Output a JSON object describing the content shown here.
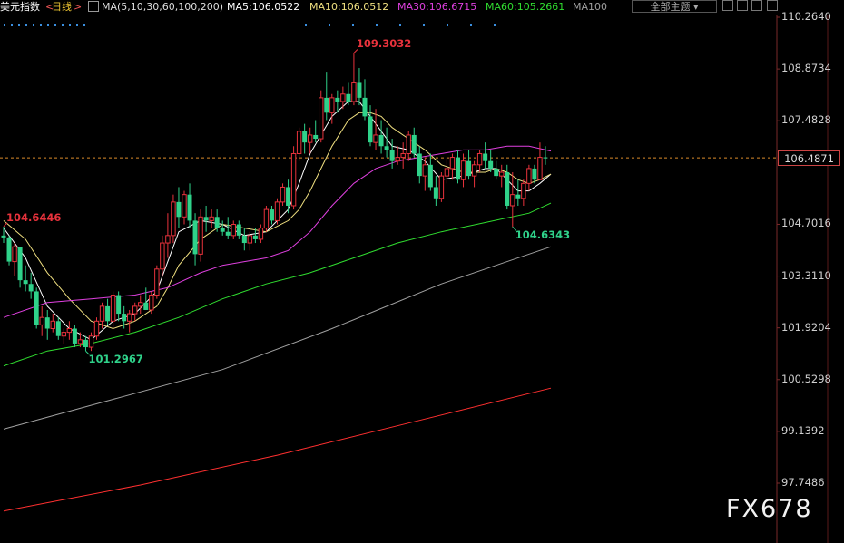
{
  "header": {
    "instrument": "美元指数",
    "period": "日线",
    "indicator": "MA(5,10,30,60,100,200)",
    "ma5": "MA5:106.0522",
    "ma10": "MA10:106.0512",
    "ma30": "MA30:106.6715",
    "ma60": "MA60:105.2661",
    "ma100": "MA100",
    "theme_button": "全部主题"
  },
  "watermark": "FX678",
  "colors": {
    "up": "#e8323c",
    "down": "#2fd28a",
    "ma5": "#ffffff",
    "ma10": "#f0e080",
    "ma30": "#e040e0",
    "ma60": "#30dd30",
    "ma100": "#a0a0a0",
    "ma200": "#ff3030",
    "grid": "#7a2a2a"
  },
  "chart_data": {
    "type": "candlestick",
    "ylim": [
      96.9,
      110.7
    ],
    "y_ticks": [
      "110.2640",
      "108.8734",
      "107.4828",
      "104.7016",
      "103.3110",
      "101.9204",
      "100.5298",
      "99.1392",
      "97.7486"
    ],
    "current_price": "106.4871",
    "annotations": [
      {
        "text": "109.3032",
        "value": 109.3032,
        "index": 64,
        "color": "up"
      },
      {
        "text": "104.6446",
        "value": 104.6446,
        "index": 0,
        "color": "up"
      },
      {
        "text": "101.2967",
        "value": 101.2967,
        "index": 15,
        "color": "down"
      },
      {
        "text": "104.6343",
        "value": 104.6343,
        "index": 93,
        "color": "down"
      }
    ],
    "candles": [
      [
        104.4,
        104.64,
        104.2,
        104.35
      ],
      [
        104.35,
        104.4,
        103.6,
        103.7
      ],
      [
        103.7,
        104.2,
        103.3,
        104.1
      ],
      [
        104.1,
        104.1,
        103.0,
        103.2
      ],
      [
        103.2,
        103.6,
        102.9,
        103.1
      ],
      [
        103.1,
        103.4,
        102.7,
        102.9
      ],
      [
        102.9,
        103.0,
        101.9,
        102.0
      ],
      [
        102.0,
        102.5,
        101.7,
        102.2
      ],
      [
        102.2,
        102.4,
        101.6,
        101.9
      ],
      [
        101.9,
        102.3,
        101.8,
        102.1
      ],
      [
        102.1,
        102.2,
        101.6,
        101.7
      ],
      [
        101.7,
        101.9,
        101.5,
        101.8
      ],
      [
        101.8,
        102.1,
        101.6,
        101.9
      ],
      [
        101.9,
        102.0,
        101.4,
        101.5
      ],
      [
        101.5,
        101.8,
        101.4,
        101.6
      ],
      [
        101.6,
        101.7,
        101.3,
        101.4
      ],
      [
        101.4,
        101.8,
        101.3,
        101.7
      ],
      [
        101.7,
        102.2,
        101.6,
        102.1
      ],
      [
        102.1,
        102.6,
        101.9,
        102.5
      ],
      [
        102.5,
        102.7,
        102.0,
        102.1
      ],
      [
        102.1,
        102.9,
        101.9,
        102.8
      ],
      [
        102.8,
        102.9,
        102.1,
        102.3
      ],
      [
        102.3,
        102.5,
        101.9,
        102.1
      ],
      [
        102.1,
        102.4,
        101.8,
        102.3
      ],
      [
        102.3,
        102.6,
        102.1,
        102.5
      ],
      [
        102.5,
        102.8,
        102.3,
        102.6
      ],
      [
        102.6,
        103.0,
        102.4,
        102.4
      ],
      [
        102.4,
        102.9,
        102.3,
        102.8
      ],
      [
        102.8,
        103.6,
        102.7,
        103.5
      ],
      [
        103.5,
        104.4,
        103.3,
        104.2
      ],
      [
        104.2,
        105.0,
        103.8,
        104.4
      ],
      [
        104.4,
        105.5,
        104.2,
        105.3
      ],
      [
        105.3,
        105.7,
        104.6,
        104.9
      ],
      [
        104.9,
        105.6,
        104.7,
        105.5
      ],
      [
        105.5,
        105.8,
        104.6,
        104.8
      ],
      [
        104.8,
        105.0,
        103.6,
        103.9
      ],
      [
        103.9,
        105.1,
        103.7,
        104.9
      ],
      [
        104.9,
        105.2,
        104.5,
        104.8
      ],
      [
        104.8,
        105.1,
        104.6,
        104.9
      ],
      [
        104.9,
        105.1,
        104.5,
        104.6
      ],
      [
        104.6,
        104.8,
        104.4,
        104.5
      ],
      [
        104.5,
        104.9,
        104.3,
        104.4
      ],
      [
        104.4,
        104.8,
        104.3,
        104.7
      ],
      [
        104.7,
        104.8,
        104.3,
        104.4
      ],
      [
        104.4,
        104.6,
        104.0,
        104.2
      ],
      [
        104.2,
        104.5,
        104.0,
        104.4
      ],
      [
        104.4,
        104.6,
        104.2,
        104.3
      ],
      [
        104.3,
        104.7,
        104.2,
        104.6
      ],
      [
        104.6,
        105.2,
        104.5,
        105.1
      ],
      [
        105.1,
        105.2,
        104.7,
        104.8
      ],
      [
        104.8,
        105.4,
        104.7,
        105.3
      ],
      [
        105.3,
        105.8,
        105.2,
        105.7
      ],
      [
        105.7,
        105.9,
        105.0,
        105.2
      ],
      [
        105.2,
        106.8,
        105.1,
        106.6
      ],
      [
        106.6,
        107.3,
        106.4,
        107.2
      ],
      [
        107.2,
        107.4,
        106.6,
        106.9
      ],
      [
        106.9,
        107.3,
        106.6,
        107.1
      ],
      [
        107.1,
        107.5,
        106.9,
        107.0
      ],
      [
        107.0,
        108.3,
        106.9,
        108.1
      ],
      [
        108.1,
        108.8,
        107.5,
        107.7
      ],
      [
        107.7,
        108.2,
        107.4,
        108.1
      ],
      [
        108.1,
        108.3,
        107.7,
        108.0
      ],
      [
        108.0,
        108.4,
        107.8,
        108.2
      ],
      [
        108.2,
        108.5,
        107.9,
        108.0
      ],
      [
        108.0,
        109.3,
        107.9,
        108.5
      ],
      [
        108.5,
        108.9,
        107.9,
        108.1
      ],
      [
        108.1,
        108.6,
        107.5,
        107.6
      ],
      [
        107.6,
        107.9,
        106.8,
        106.9
      ],
      [
        106.9,
        107.8,
        106.7,
        107.1
      ],
      [
        107.1,
        107.5,
        106.6,
        106.8
      ],
      [
        106.8,
        107.3,
        106.5,
        106.7
      ],
      [
        106.7,
        107.0,
        106.2,
        106.4
      ],
      [
        106.4,
        106.8,
        106.3,
        106.5
      ],
      [
        106.5,
        106.9,
        106.2,
        106.6
      ],
      [
        106.6,
        107.2,
        106.4,
        107.1
      ],
      [
        107.1,
        107.3,
        106.5,
        106.6
      ],
      [
        106.6,
        106.8,
        105.8,
        106.0
      ],
      [
        106.0,
        106.5,
        105.6,
        106.3
      ],
      [
        106.3,
        106.6,
        105.6,
        105.7
      ],
      [
        105.7,
        106.0,
        105.2,
        105.4
      ],
      [
        105.4,
        106.1,
        105.3,
        106.0
      ],
      [
        106.0,
        106.5,
        105.8,
        106.2
      ],
      [
        106.2,
        106.6,
        105.9,
        106.5
      ],
      [
        106.5,
        106.7,
        105.8,
        105.9
      ],
      [
        105.9,
        106.6,
        105.7,
        106.4
      ],
      [
        106.4,
        106.7,
        105.9,
        106.0
      ],
      [
        106.0,
        106.4,
        105.7,
        106.3
      ],
      [
        106.3,
        106.7,
        106.1,
        106.6
      ],
      [
        106.6,
        106.9,
        106.2,
        106.4
      ],
      [
        106.4,
        106.7,
        106.1,
        106.2
      ],
      [
        106.2,
        106.4,
        105.9,
        106.0
      ],
      [
        106.0,
        106.3,
        105.7,
        106.1
      ],
      [
        106.1,
        106.3,
        105.1,
        105.2
      ],
      [
        105.2,
        106.1,
        104.63,
        105.5
      ],
      [
        105.5,
        105.9,
        105.2,
        105.4
      ],
      [
        105.4,
        105.9,
        105.2,
        105.8
      ],
      [
        105.8,
        106.3,
        105.6,
        106.2
      ],
      [
        106.2,
        106.3,
        105.8,
        105.9
      ],
      [
        105.9,
        106.9,
        105.9,
        106.5
      ],
      [
        106.5,
        106.8,
        106.3,
        106.49
      ]
    ],
    "ma_lines": [
      {
        "key": "ma5",
        "points": [
          [
            0,
            104.6
          ],
          [
            4,
            103.8
          ],
          [
            8,
            102.5
          ],
          [
            12,
            101.9
          ],
          [
            16,
            101.6
          ],
          [
            20,
            102.1
          ],
          [
            24,
            102.3
          ],
          [
            28,
            102.9
          ],
          [
            30,
            103.7
          ],
          [
            32,
            104.5
          ],
          [
            36,
            104.8
          ],
          [
            40,
            104.7
          ],
          [
            44,
            104.4
          ],
          [
            48,
            104.5
          ],
          [
            52,
            105.1
          ],
          [
            54,
            105.8
          ],
          [
            56,
            106.6
          ],
          [
            58,
            107.1
          ],
          [
            60,
            107.6
          ],
          [
            63,
            108.0
          ],
          [
            65,
            108.0
          ],
          [
            67,
            107.6
          ],
          [
            69,
            107.2
          ],
          [
            71,
            106.8
          ],
          [
            74,
            106.7
          ],
          [
            77,
            106.4
          ],
          [
            80,
            105.9
          ],
          [
            84,
            106.0
          ],
          [
            88,
            106.2
          ],
          [
            90,
            106.2
          ],
          [
            92,
            105.9
          ],
          [
            94,
            105.6
          ],
          [
            96,
            105.6
          ],
          [
            98,
            105.8
          ],
          [
            100,
            106.05
          ]
        ]
      },
      {
        "key": "ma10",
        "points": [
          [
            0,
            104.8
          ],
          [
            4,
            104.3
          ],
          [
            8,
            103.4
          ],
          [
            12,
            102.7
          ],
          [
            16,
            102.1
          ],
          [
            20,
            101.9
          ],
          [
            24,
            102.1
          ],
          [
            28,
            102.5
          ],
          [
            30,
            103.0
          ],
          [
            32,
            103.6
          ],
          [
            36,
            104.3
          ],
          [
            40,
            104.7
          ],
          [
            44,
            104.6
          ],
          [
            48,
            104.5
          ],
          [
            52,
            104.8
          ],
          [
            54,
            105.1
          ],
          [
            56,
            105.6
          ],
          [
            58,
            106.2
          ],
          [
            60,
            106.8
          ],
          [
            63,
            107.5
          ],
          [
            65,
            107.7
          ],
          [
            67,
            107.7
          ],
          [
            69,
            107.6
          ],
          [
            71,
            107.3
          ],
          [
            74,
            107.0
          ],
          [
            77,
            106.7
          ],
          [
            80,
            106.3
          ],
          [
            84,
            106.1
          ],
          [
            88,
            106.1
          ],
          [
            90,
            106.2
          ],
          [
            92,
            106.1
          ],
          [
            94,
            105.9
          ],
          [
            96,
            105.8
          ],
          [
            98,
            105.9
          ],
          [
            100,
            106.05
          ]
        ]
      },
      {
        "key": "ma30",
        "points": [
          [
            0,
            102.2
          ],
          [
            8,
            102.6
          ],
          [
            16,
            102.7
          ],
          [
            24,
            102.8
          ],
          [
            30,
            103.0
          ],
          [
            36,
            103.4
          ],
          [
            40,
            103.6
          ],
          [
            44,
            103.7
          ],
          [
            48,
            103.8
          ],
          [
            52,
            104.0
          ],
          [
            56,
            104.5
          ],
          [
            60,
            105.2
          ],
          [
            64,
            105.8
          ],
          [
            68,
            106.2
          ],
          [
            72,
            106.4
          ],
          [
            76,
            106.5
          ],
          [
            80,
            106.6
          ],
          [
            84,
            106.7
          ],
          [
            88,
            106.7
          ],
          [
            92,
            106.8
          ],
          [
            96,
            106.8
          ],
          [
            100,
            106.67
          ]
        ]
      },
      {
        "key": "ma60",
        "points": [
          [
            0,
            100.9
          ],
          [
            8,
            101.3
          ],
          [
            16,
            101.5
          ],
          [
            24,
            101.8
          ],
          [
            32,
            102.2
          ],
          [
            40,
            102.7
          ],
          [
            48,
            103.1
          ],
          [
            56,
            103.4
          ],
          [
            64,
            103.8
          ],
          [
            72,
            104.2
          ],
          [
            80,
            104.5
          ],
          [
            88,
            104.75
          ],
          [
            96,
            105.0
          ],
          [
            100,
            105.27
          ]
        ]
      },
      {
        "key": "ma100",
        "points": [
          [
            0,
            99.2
          ],
          [
            20,
            100.0
          ],
          [
            40,
            100.8
          ],
          [
            60,
            101.9
          ],
          [
            70,
            102.5
          ],
          [
            80,
            103.1
          ],
          [
            90,
            103.6
          ],
          [
            100,
            104.1
          ]
        ]
      },
      {
        "key": "ma200",
        "points": [
          [
            0,
            97.0
          ],
          [
            25,
            97.7
          ],
          [
            50,
            98.5
          ],
          [
            75,
            99.4
          ],
          [
            100,
            100.3
          ]
        ]
      }
    ]
  }
}
